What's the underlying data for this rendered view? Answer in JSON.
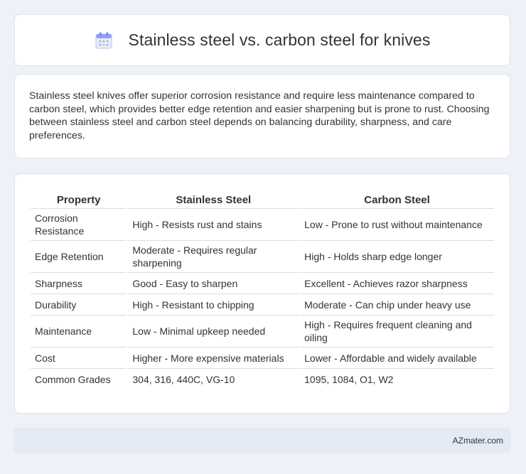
{
  "header": {
    "title": "Stainless steel vs. carbon steel for knives",
    "icon": "calendar-icon"
  },
  "intro": {
    "text": "Stainless steel knives offer superior corrosion resistance and require less maintenance compared to carbon steel, which provides better edge retention and easier sharpening but is prone to rust. Choosing between stainless steel and carbon steel depends on balancing durability, sharpness, and care preferences."
  },
  "table": {
    "headers": [
      "Property",
      "Stainless Steel",
      "Carbon Steel"
    ],
    "rows": [
      [
        "Corrosion Resistance",
        "High - Resists rust and stains",
        "Low - Prone to rust without maintenance"
      ],
      [
        "Edge Retention",
        "Moderate - Requires regular sharpening",
        "High - Holds sharp edge longer"
      ],
      [
        "Sharpness",
        "Good - Easy to sharpen",
        "Excellent - Achieves razor sharpness"
      ],
      [
        "Durability",
        "High - Resistant to chipping",
        "Moderate - Can chip under heavy use"
      ],
      [
        "Maintenance",
        "Low - Minimal upkeep needed",
        "High - Requires frequent cleaning and oiling"
      ],
      [
        "Cost",
        "Higher - More expensive materials",
        "Lower - Affordable and widely available"
      ],
      [
        "Common Grades",
        "304, 316, 440C, VG-10",
        "1095, 1084, O1, W2"
      ]
    ]
  },
  "footer": {
    "brand": "AZmater.com"
  },
  "colors": {
    "background": "#eef1f7",
    "card": "#ffffff",
    "footer": "#e3e9f5",
    "icon_accent": "#7b8ff0"
  }
}
